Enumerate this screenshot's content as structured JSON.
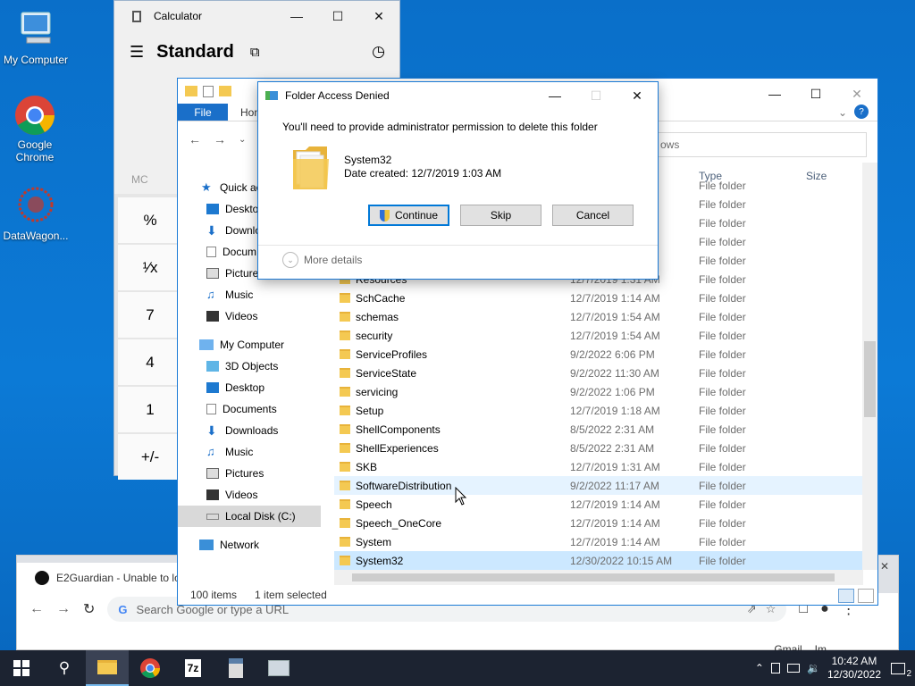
{
  "desktop": {
    "icons": [
      {
        "label": "My Computer"
      },
      {
        "label": "Google Chrome"
      },
      {
        "label": "DataWagon..."
      }
    ]
  },
  "calculator": {
    "title": "Calculator",
    "mode": "Standard",
    "memory_label": "MC",
    "keys": [
      "%",
      "¹⁄x",
      "7",
      "4",
      "1",
      "+/-"
    ]
  },
  "explorer": {
    "ribbon": {
      "file": "File",
      "home": "Hon"
    },
    "search_placeholder": "ows",
    "nav": [
      {
        "label": "Quick ac",
        "icon": "star-icon"
      },
      {
        "label": "Deskto",
        "icon": "desktop-icon"
      },
      {
        "label": "Downlo",
        "icon": "download-icon"
      },
      {
        "label": "Docum",
        "icon": "document-icon"
      },
      {
        "label": "Picture",
        "icon": "picture-icon"
      },
      {
        "label": "Music",
        "icon": "music-icon"
      },
      {
        "label": "Videos",
        "icon": "video-icon"
      },
      {
        "label": "My Computer",
        "icon": "computer-icon"
      },
      {
        "label": "3D Objects",
        "icon": "cube-icon"
      },
      {
        "label": "Desktop",
        "icon": "desktop-icon"
      },
      {
        "label": "Documents",
        "icon": "document-icon"
      },
      {
        "label": "Downloads",
        "icon": "download-icon"
      },
      {
        "label": "Music",
        "icon": "music-icon"
      },
      {
        "label": "Pictures",
        "icon": "picture-icon"
      },
      {
        "label": "Videos",
        "icon": "video-icon"
      },
      {
        "label": "Local Disk (C:)",
        "icon": "drive-icon"
      },
      {
        "label": "Network",
        "icon": "network-icon"
      }
    ],
    "columns": {
      "type": "Type",
      "size": "Size"
    },
    "rows": [
      {
        "name": "",
        "date": "",
        "type": "File folder"
      },
      {
        "name": "",
        "date": "",
        "type": "File folder"
      },
      {
        "name": "",
        "date": "",
        "type": "File folder"
      },
      {
        "name": "",
        "date": "",
        "type": "File folder"
      },
      {
        "name": "",
        "date": "",
        "type": "File folder"
      },
      {
        "name": "Resources",
        "date": "12/7/2019 1:31 AM",
        "type": "File folder"
      },
      {
        "name": "SchCache",
        "date": "12/7/2019 1:14 AM",
        "type": "File folder"
      },
      {
        "name": "schemas",
        "date": "12/7/2019 1:54 AM",
        "type": "File folder"
      },
      {
        "name": "security",
        "date": "12/7/2019 1:54 AM",
        "type": "File folder"
      },
      {
        "name": "ServiceProfiles",
        "date": "9/2/2022 6:06 PM",
        "type": "File folder"
      },
      {
        "name": "ServiceState",
        "date": "9/2/2022 11:30 AM",
        "type": "File folder"
      },
      {
        "name": "servicing",
        "date": "9/2/2022 1:06 PM",
        "type": "File folder"
      },
      {
        "name": "Setup",
        "date": "12/7/2019 1:18 AM",
        "type": "File folder"
      },
      {
        "name": "ShellComponents",
        "date": "8/5/2022 2:31 AM",
        "type": "File folder"
      },
      {
        "name": "ShellExperiences",
        "date": "8/5/2022 2:31 AM",
        "type": "File folder"
      },
      {
        "name": "SKB",
        "date": "12/7/2019 1:31 AM",
        "type": "File folder"
      },
      {
        "name": "SoftwareDistribution",
        "date": "9/2/2022 11:17 AM",
        "type": "File folder"
      },
      {
        "name": "Speech",
        "date": "12/7/2019 1:14 AM",
        "type": "File folder"
      },
      {
        "name": "Speech_OneCore",
        "date": "12/7/2019 1:14 AM",
        "type": "File folder"
      },
      {
        "name": "System",
        "date": "12/7/2019 1:14 AM",
        "type": "File folder"
      },
      {
        "name": "System32",
        "date": "12/30/2022 10:15 AM",
        "type": "File folder"
      }
    ],
    "status": {
      "items": "100 items",
      "selected": "1 item selected"
    }
  },
  "dialog": {
    "title": "Folder Access Denied",
    "message": "You'll need to provide administrator permission to delete this folder",
    "folder_name": "System32",
    "date_created": "Date created: 12/7/2019 1:03 AM",
    "buttons": {
      "continue": "Continue",
      "skip": "Skip",
      "cancel": "Cancel"
    },
    "more_details": "More details"
  },
  "chrome": {
    "tab_title": "E2Guardian - Unable to lo",
    "omnibox_placeholder": "Search Google or type a URL",
    "bottom_links": [
      "Gmail",
      "Im"
    ]
  },
  "taskbar": {
    "time": "10:42 AM",
    "date": "12/30/2022",
    "notification_count": "2",
    "apps": [
      "file-explorer-icon",
      "chrome-icon",
      "7zip-icon",
      "calculator-icon",
      "app-icon"
    ]
  },
  "colors": {
    "accent": "#0078d7",
    "file_tab": "#1a6fc9",
    "taskbar": "#1c2331"
  }
}
